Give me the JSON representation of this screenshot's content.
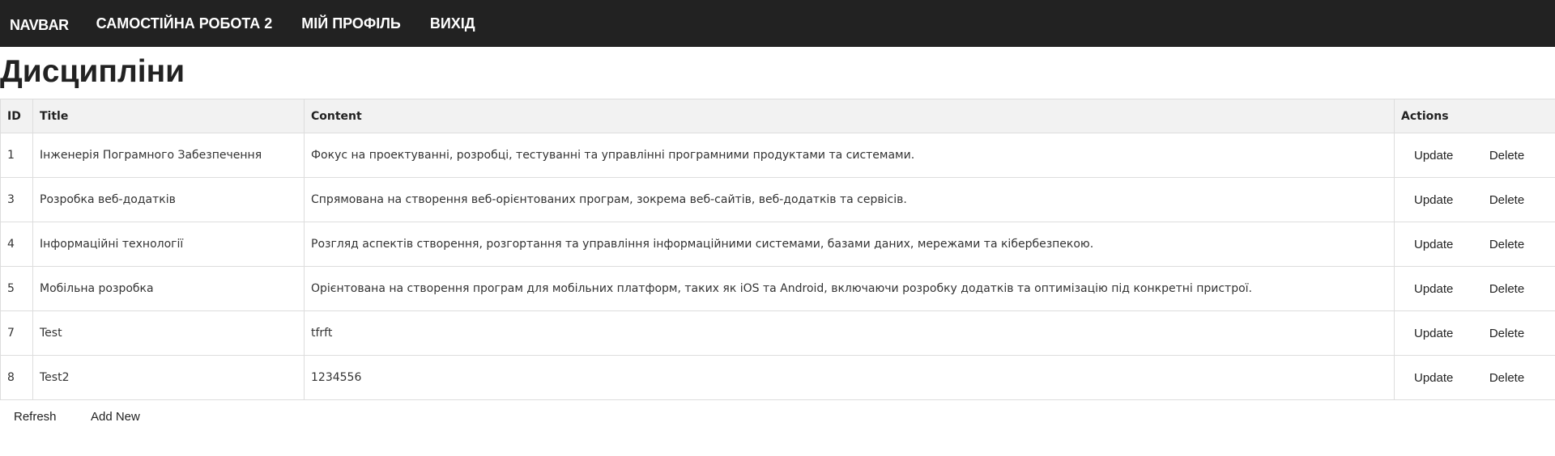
{
  "navbar": {
    "brand": "NAVBAR",
    "links": [
      {
        "label": "САМОСТІЙНА РОБОТА 2"
      },
      {
        "label": "МІЙ ПРОФІЛЬ"
      },
      {
        "label": "ВИХІД"
      }
    ]
  },
  "page": {
    "title": "Дисципліни"
  },
  "table": {
    "columns": [
      "ID",
      "Title",
      "Content",
      "Actions"
    ],
    "rows": [
      {
        "id": "1",
        "title": "Інженерія Пограмного Забезпечення",
        "content": "Фокус на проектуванні, розробці, тестуванні та управлінні програмними продуктами та системами.",
        "update": "Update",
        "delete": "Delete"
      },
      {
        "id": "3",
        "title": "Розробка веб-додатків",
        "content": "Спрямована на створення веб-орієнтованих програм, зокрема веб-сайтів, веб-додатків та сервісів.",
        "update": "Update",
        "delete": "Delete"
      },
      {
        "id": "4",
        "title": "Інформаційні технології",
        "content": "Розгляд аспектів створення, розгортання та управління інформаційними системами, базами даних, мережами та кібербезпекою.",
        "update": "Update",
        "delete": "Delete"
      },
      {
        "id": "5",
        "title": "Мобільна розробка",
        "content": "Орієнтована на створення програм для мобільних платформ, таких як iOS та Android, включаючи розробку додатків та оптимізацію під конкретні пристрої.",
        "update": "Update",
        "delete": "Delete"
      },
      {
        "id": "7",
        "title": "Test",
        "content": "tfrft",
        "update": "Update",
        "delete": "Delete"
      },
      {
        "id": "8",
        "title": "Test2",
        "content": "1234556",
        "update": "Update",
        "delete": "Delete"
      }
    ]
  },
  "footer": {
    "refresh_label": "Refresh",
    "add_new_label": "Add New"
  }
}
